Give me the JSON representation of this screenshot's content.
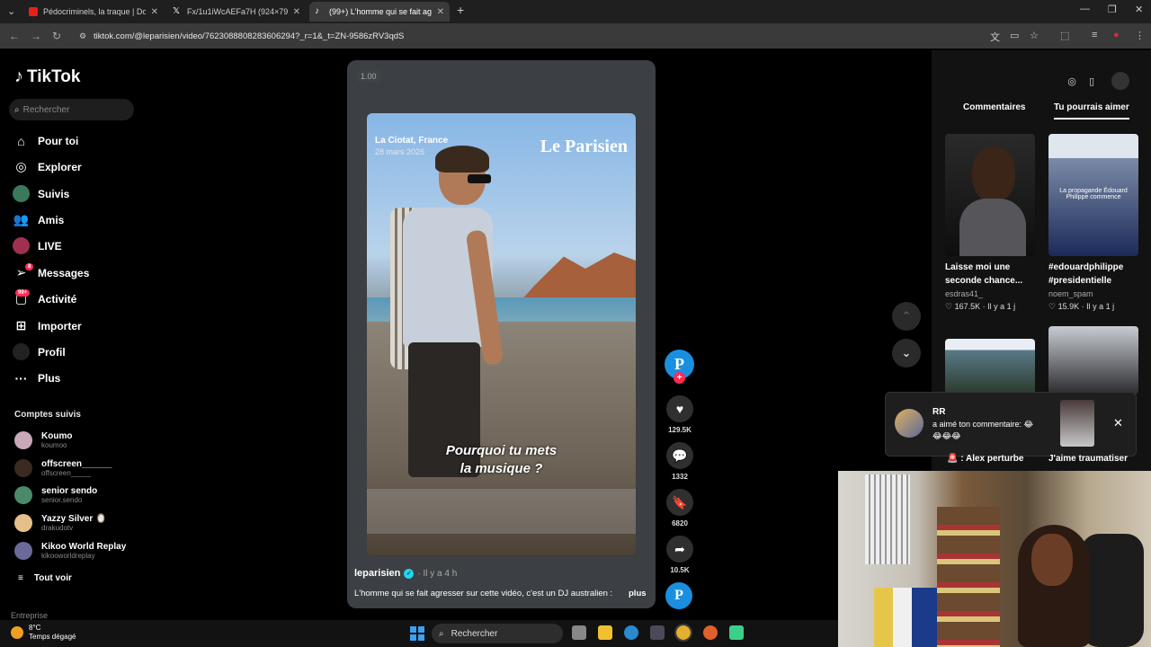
{
  "browser": {
    "tabs": [
      {
        "title": "Pédocriminels, la traque | Docu",
        "favicon_color": "#e62117",
        "active": false
      },
      {
        "title": "Fx/1u1iWcAEFa7H (924×790)",
        "favicon_color": "#ffffff",
        "active": false
      },
      {
        "title": "(99+) L'homme qui se fait agres",
        "favicon_color": "#ffffff",
        "active": true
      }
    ],
    "new_tab": "+",
    "url": "tiktok.com/@leparisien/video/7623088808283606294?_r=1&_t=ZN-9586zRV3qdS"
  },
  "sidebar": {
    "logo": "TikTok",
    "search_placeholder": "Rechercher",
    "nav": [
      {
        "label": "Pour toi",
        "icon": "home-icon"
      },
      {
        "label": "Explorer",
        "icon": "compass-icon"
      },
      {
        "label": "Suivis",
        "icon": "following-avatar"
      },
      {
        "label": "Amis",
        "icon": "friends-icon"
      },
      {
        "label": "LIVE",
        "icon": "live-avatar"
      },
      {
        "label": "Messages",
        "icon": "send-icon",
        "badge": "8"
      },
      {
        "label": "Activité",
        "icon": "inbox-icon",
        "badge": "99+"
      },
      {
        "label": "Importer",
        "icon": "upload-icon"
      },
      {
        "label": "Profil",
        "icon": "profile-avatar"
      },
      {
        "label": "Plus",
        "icon": "more-icon"
      }
    ],
    "following_title": "Comptes suivis",
    "accounts": [
      {
        "name": "Koumo",
        "handle": "koumoo",
        "color": "#c9a8b8"
      },
      {
        "name": "offscreen______",
        "handle": "offscreen_____",
        "color": "#333333"
      },
      {
        "name": "senior sendo",
        "handle": "senior.sendo",
        "color": "#4a8a6a"
      },
      {
        "name": "Yazzy Silver 🪞",
        "handle": "drakudotv",
        "color": "#e6c08a"
      },
      {
        "name": "Kikoo World Replay",
        "handle": "kikooworldreplay",
        "color": "#6a6a9a"
      }
    ],
    "see_all": "Tout voir",
    "footer": "Entreprise"
  },
  "video": {
    "speed": "1.00",
    "location": "La Ciotat, France",
    "date": "28 mars 2026",
    "brand": "Le Parisien",
    "caption_line1": "Pourquoi tu mets",
    "caption_line2": "la musique ?",
    "author": "leparisien",
    "time": "· Il y a 4 h",
    "description": "L'homme qui se fait agresser sur cette vidéo, c'est un DJ australien :",
    "more": "plus"
  },
  "actions": {
    "creator_initial": "P",
    "likes": "129.5K",
    "comments": "1332",
    "saves": "6820",
    "shares": "10.5K"
  },
  "right_panel": {
    "tab_comments": "Commentaires",
    "tab_suggested": "Tu pourrais aimer",
    "items": [
      {
        "caption": "Laisse moi une seconde chance...",
        "user": "esdras41_",
        "likes": "167.5K",
        "age": "Il y a 1 j"
      },
      {
        "caption": "#edouardphilippe #presidentielle",
        "user": "noem_spam",
        "likes": "15.9K",
        "age": "Il y a 1 j",
        "overlay": "La propagande Édouard Philippe commence"
      }
    ],
    "notification": {
      "user": "RR",
      "message": "a aimé ton commentaire: 😂",
      "emojis": "😂😂😂"
    },
    "below_titles": [
      "🚨 : Alex perturbe",
      "J'aime traumatiser"
    ]
  },
  "taskbar": {
    "temperature": "8°C",
    "weather": "Temps dégagé",
    "search": "Rechercher"
  }
}
